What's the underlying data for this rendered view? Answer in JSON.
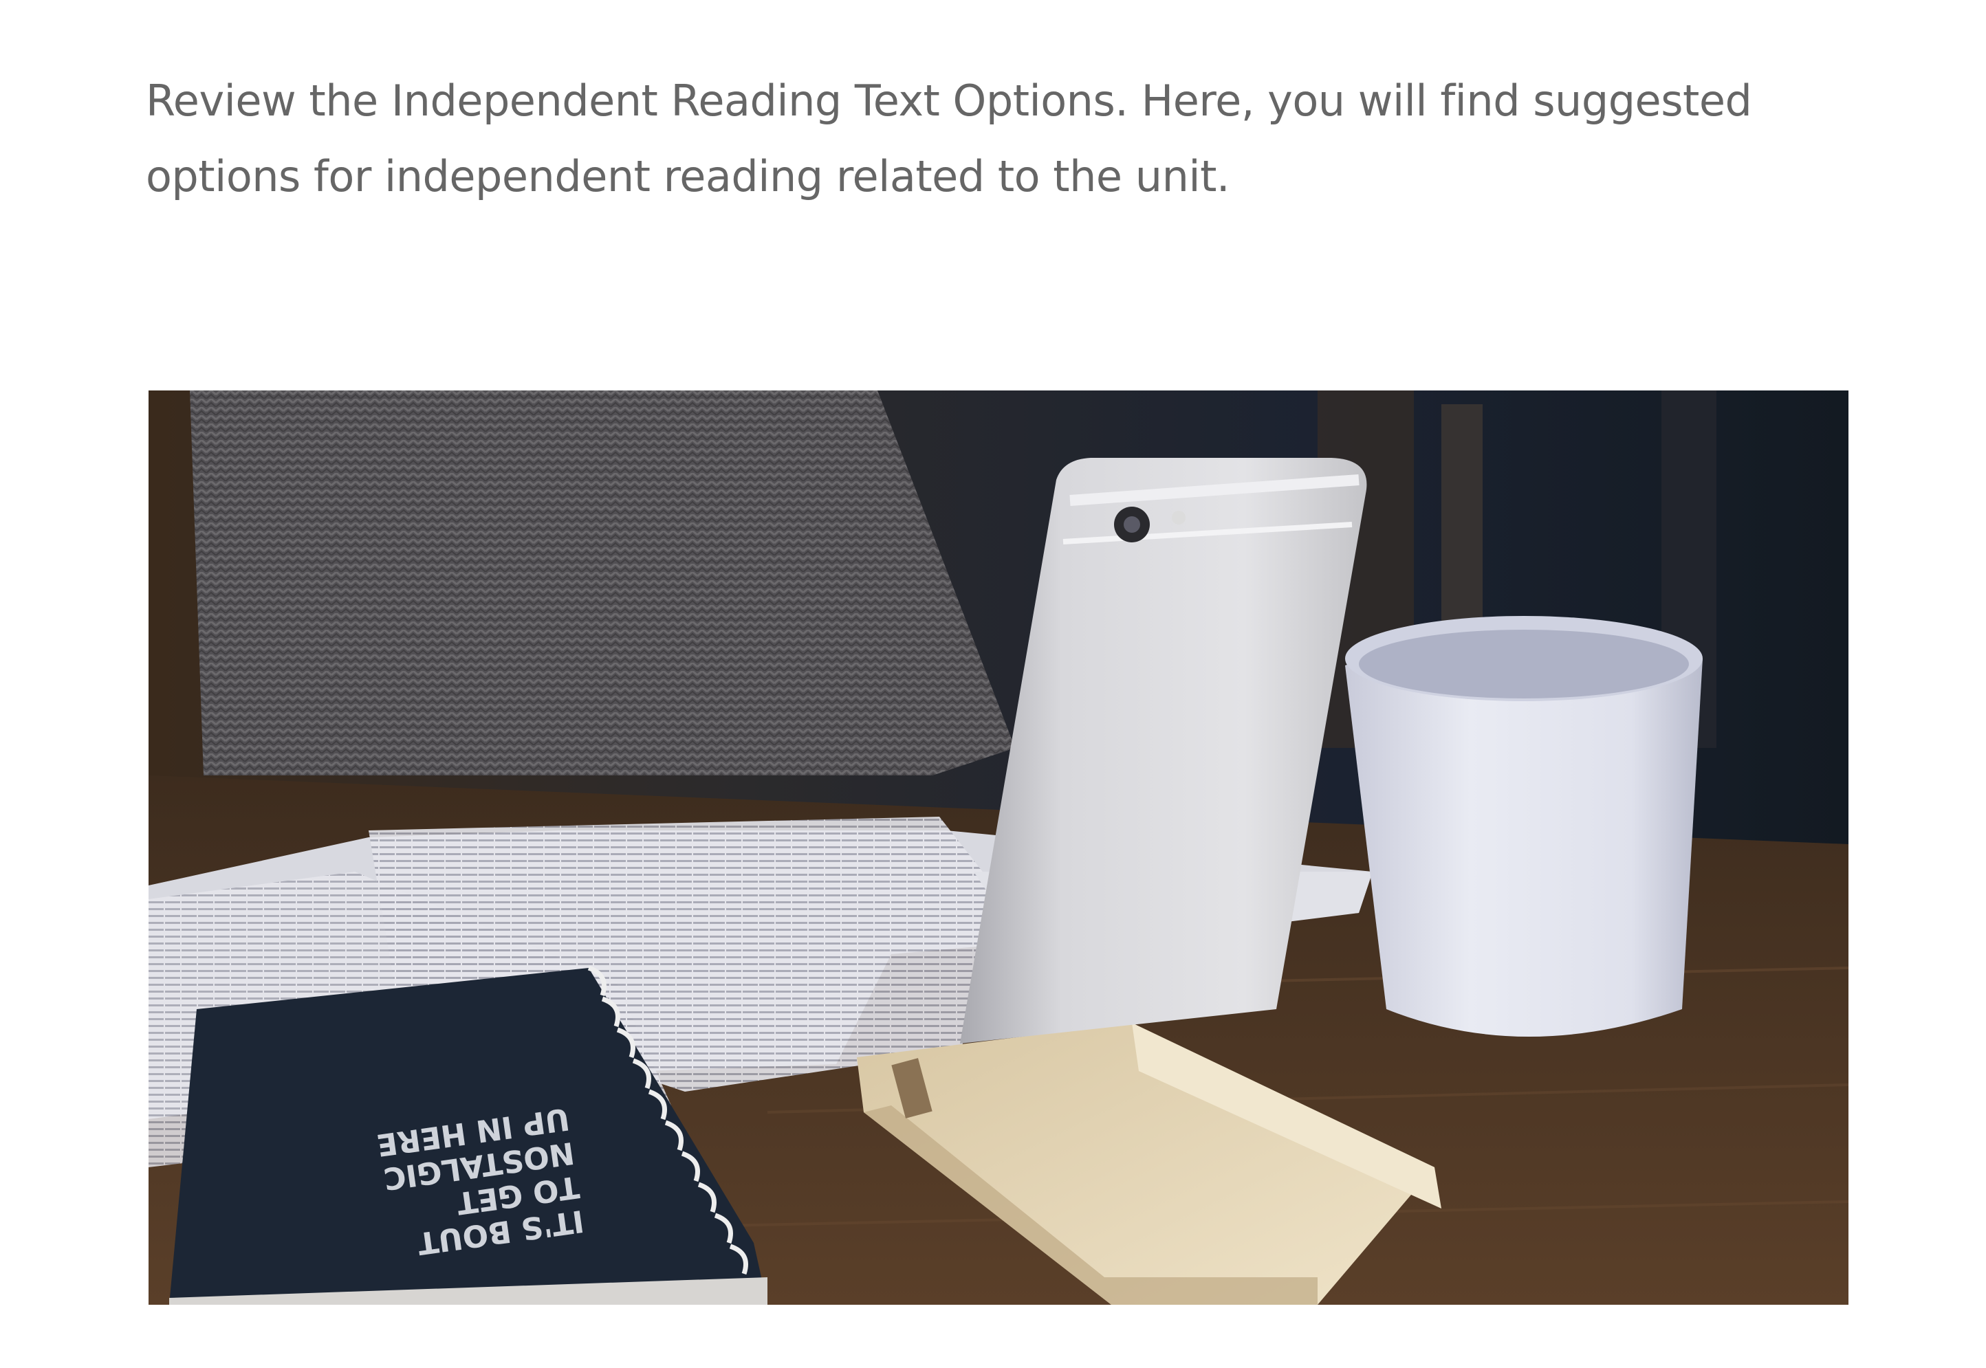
{
  "content": {
    "intro_text": "Review the Independent Reading Text Options. Here, you will find suggested options for independent reading related to the unit."
  },
  "image": {
    "description_icon": "desk-photo",
    "notebook_lines": [
      "IT'S BOUT",
      "TO GET",
      "NOSTALGIC",
      "UP IN HERE"
    ]
  }
}
